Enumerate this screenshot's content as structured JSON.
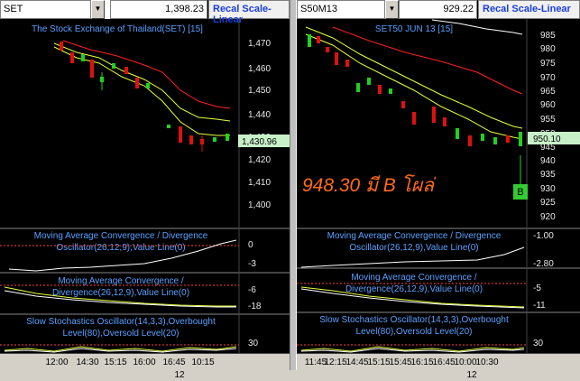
{
  "left": {
    "symbol": "SET",
    "price": "1,398.23",
    "recal": "Recal Scale-Linear",
    "title": "The Stock Exchange of Thailand(SET) [15]",
    "last_price_tag": "1,430.96",
    "yticks": [
      "1,470",
      "1,460",
      "1,450",
      "1,440",
      "1,430",
      "1,420",
      "1,410",
      "1,400"
    ],
    "macd1_title_1": "Moving Average Convergence / Divergence",
    "macd1_title_2": "Oscillator(26,12,9),Value Line(0)",
    "macd1_ticks": [
      "0",
      "-3"
    ],
    "macd2_title_1": "Moving Average Convergence /",
    "macd2_title_2": "Divergence(26,12,9),Value Line(0)",
    "macd2_ticks": [
      "-6",
      "-18"
    ],
    "stoch_title_1": "Slow Stochastics Oscillator(14,3,3),Overbought",
    "stoch_title_2": "Level(80),Oversold Level(20)",
    "stoch_ticks": [
      "30"
    ],
    "times": [
      "12:00",
      "14:30",
      "15:15",
      "16:00",
      "16:45",
      "10:15"
    ],
    "day": "12"
  },
  "right": {
    "symbol": "S50M13",
    "price": "929.22",
    "recal": "Recal Scale-Linear",
    "title": "SET50 JUN 13  [15]",
    "last_price_tag": "950.10",
    "yticks": [
      "985",
      "980",
      "975",
      "970",
      "965",
      "960",
      "955",
      "950",
      "945",
      "940",
      "935",
      "930",
      "925",
      "920"
    ],
    "signal_badge": "B",
    "macd1_title_1": "Moving Average Convergence / Divergence",
    "macd1_title_2": "Oscillator(26,12,9),Value Line(0)",
    "macd1_ticks": [
      "-1.00",
      "-2.80"
    ],
    "macd2_title_1": "Moving Average Convergence /",
    "macd2_title_2": "Divergence(26,12,9),Value Line(0)",
    "macd2_ticks": [
      "-5",
      "-11"
    ],
    "stoch_title_1": "Slow Stochastics Oscillator(14,3,3),Overbought",
    "stoch_title_2": "Level(80),Oversold Level(20)",
    "stoch_ticks": [
      "30"
    ],
    "times": [
      "11:45",
      "12:15",
      "14:45",
      "15:15",
      "15:45",
      "16:15",
      "16:45",
      "10:00",
      "10:30"
    ],
    "day": "12"
  },
  "annotation": "948.30 มี B โผล่",
  "colors": {
    "bull": "#1fd21f",
    "bear": "#e01010",
    "ma_fast": "#e6ff3a",
    "ma_slow": "#ff2020",
    "ma_white": "#ffffff",
    "price_tag_bg": "#c8f0c8",
    "signal": "#33cc33",
    "title": "#5aa0ff"
  },
  "icons": {
    "dropdown": "chevron-down-icon"
  }
}
